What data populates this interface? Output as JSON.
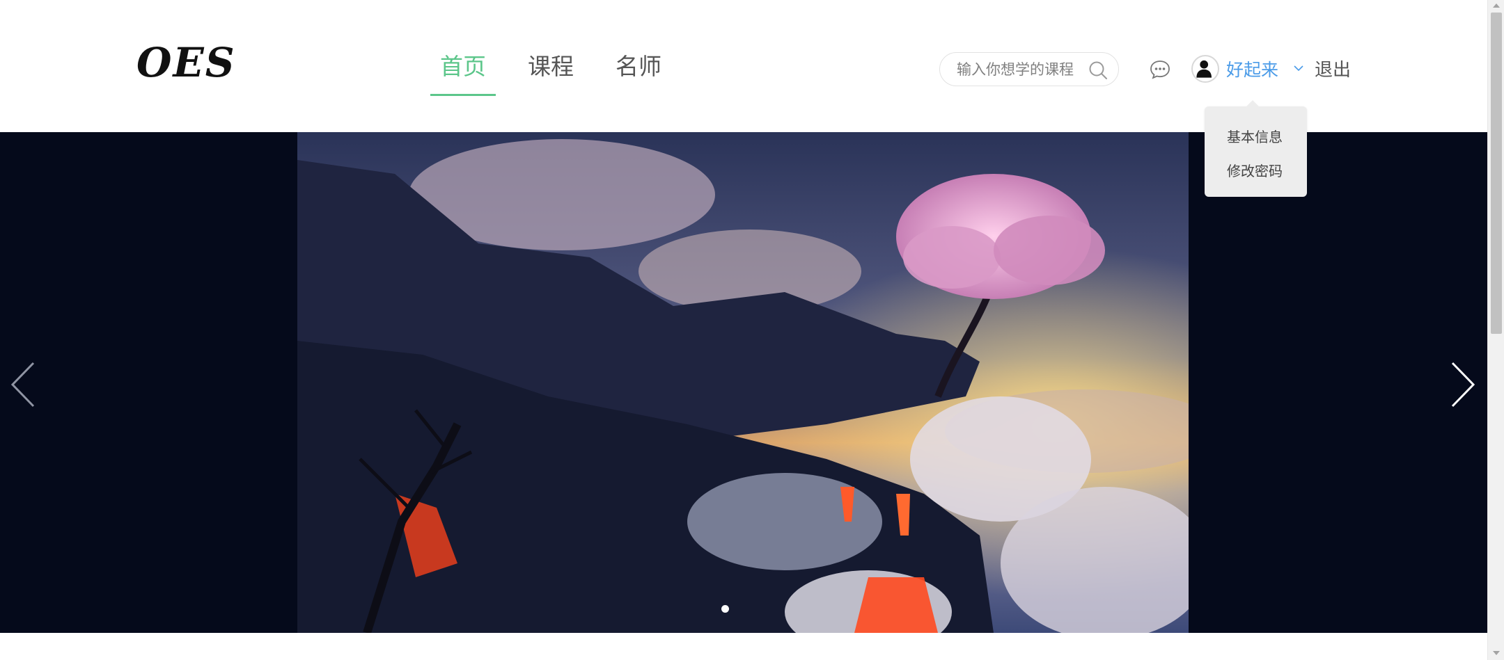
{
  "header": {
    "logo_text": "OES",
    "nav": [
      {
        "label": "首页",
        "active": true
      },
      {
        "label": "课程",
        "active": false
      },
      {
        "label": "名师",
        "active": false
      }
    ],
    "search": {
      "placeholder": "输入你想学的课程",
      "value": ""
    },
    "user": {
      "name": "好起来"
    },
    "logout_label": "退出"
  },
  "user_menu": {
    "expanded": true,
    "items": [
      "基本信息",
      "修改密码"
    ]
  },
  "banner": {
    "slide_count": 1,
    "active_slide": 1
  },
  "icons": {
    "search": "search-icon",
    "message": "message-icon",
    "avatar": "user-avatar-icon",
    "dropdown": "chevron-down-icon",
    "prev": "chevron-left-icon",
    "next": "chevron-right-icon"
  },
  "colors": {
    "accent_green": "#5cc68a",
    "user_blue": "#4a9be8",
    "banner_bg": "#050a1b",
    "dropdown_bg": "#ededed"
  }
}
